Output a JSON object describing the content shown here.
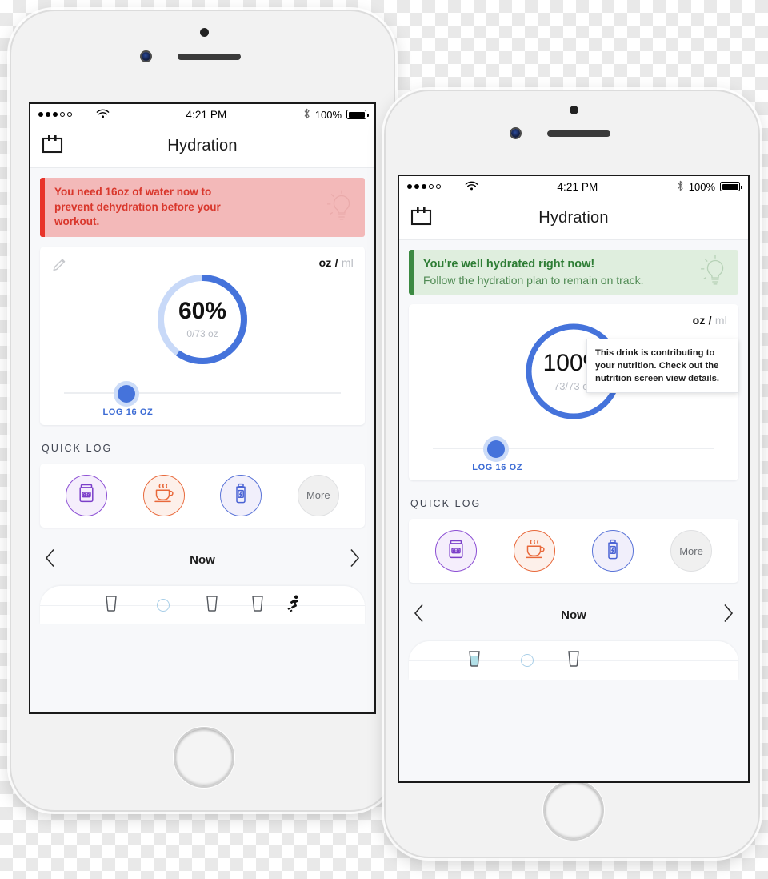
{
  "phones": [
    {
      "id": "phone-back",
      "status_bar": {
        "signal_dots_filled": 3,
        "signal_dots_total": 5,
        "wifi_icon": "wifi-icon",
        "time": "4:21 PM",
        "bluetooth_icon": "bluetooth-icon",
        "battery_percent": "100%"
      },
      "navbar": {
        "calendar_icon": "calendar-icon",
        "title": "Hydration"
      },
      "banner": {
        "type": "alert",
        "accent_color": "#e8342a",
        "background_color": "#f3b9b9",
        "text_color": "#d9372c",
        "line1": "You need 16oz of water now to",
        "line2": "prevent dehydration before your",
        "line3": "workout.",
        "bulb_icon": "lightbulb-icon"
      },
      "hydration_card": {
        "edit_icon": "pencil-icon",
        "units": {
          "selected": "oz",
          "separator": "/",
          "unselected": "ml"
        },
        "ring": {
          "percent_label": "60%",
          "amount_label": "0/73 oz",
          "percent_value": 60,
          "track_color": "#c8d9f8",
          "fill_color": "#4573db"
        },
        "slider": {
          "label": "LOG 16 OZ",
          "knob_position_percent": 18
        }
      },
      "quick_log": {
        "section_title": "QUICK LOG",
        "items": [
          {
            "icon": "supplement-jar-icon",
            "style": "purple"
          },
          {
            "icon": "coffee-cup-icon",
            "style": "orange"
          },
          {
            "icon": "energy-drink-bottle-icon",
            "style": "blue"
          },
          {
            "icon": "more-icon",
            "style": "more",
            "label": "More"
          }
        ]
      },
      "pager": {
        "prev_icon": "chevron-left-icon",
        "label": "Now",
        "next_icon": "chevron-right-icon"
      },
      "timeline": {
        "items": [
          {
            "icon": "glass-icon",
            "filled": false
          },
          {
            "icon": "circle-icon",
            "filled": false
          },
          {
            "icon": "glass-icon",
            "filled": false
          },
          {
            "icon": "glass-icon",
            "filled": false
          },
          {
            "icon": "runner-icon",
            "filled": false
          }
        ]
      }
    },
    {
      "id": "phone-front",
      "status_bar": {
        "signal_dots_filled": 3,
        "signal_dots_total": 5,
        "wifi_icon": "wifi-icon",
        "time": "4:21 PM",
        "bluetooth_icon": "bluetooth-icon",
        "battery_percent": "100%"
      },
      "navbar": {
        "calendar_icon": "calendar-icon",
        "title": "Hydration"
      },
      "banner": {
        "type": "ok",
        "accent_color": "#3c8a42",
        "background_color": "#dfeede",
        "text_color": "#2e7d35",
        "line1": "You're well hydrated right now!",
        "line2": "Follow the hydration plan to remain on track.",
        "bulb_icon": "lightbulb-icon"
      },
      "hydration_card": {
        "units": {
          "selected": "oz",
          "separator": "/",
          "unselected": "ml"
        },
        "ring": {
          "percent_label": "100%",
          "amount_label": "73/73 oz",
          "percent_value": 100,
          "track_color": "#c8d9f8",
          "fill_color": "#4573db"
        },
        "slider": {
          "label": "LOG 16 OZ",
          "knob_position_percent": 18
        }
      },
      "quick_log": {
        "section_title": "QUICK LOG",
        "items": [
          {
            "icon": "supplement-jar-icon",
            "style": "purple"
          },
          {
            "icon": "coffee-cup-icon",
            "style": "orange"
          },
          {
            "icon": "energy-drink-bottle-icon",
            "style": "blue"
          },
          {
            "icon": "more-icon",
            "style": "more",
            "label": "More"
          }
        ]
      },
      "pager": {
        "prev_icon": "chevron-left-icon",
        "label": "Now",
        "next_icon": "chevron-right-icon"
      },
      "timeline": {
        "items": [
          {
            "icon": "glass-icon",
            "filled": true
          },
          {
            "icon": "circle-icon",
            "filled": false
          },
          {
            "icon": "glass-icon",
            "filled": false
          }
        ]
      },
      "tooltip": {
        "line1": "This drink is contributing to",
        "line2": "your nutrition. Check out the",
        "line3": "nutrition screen view details."
      }
    }
  ]
}
